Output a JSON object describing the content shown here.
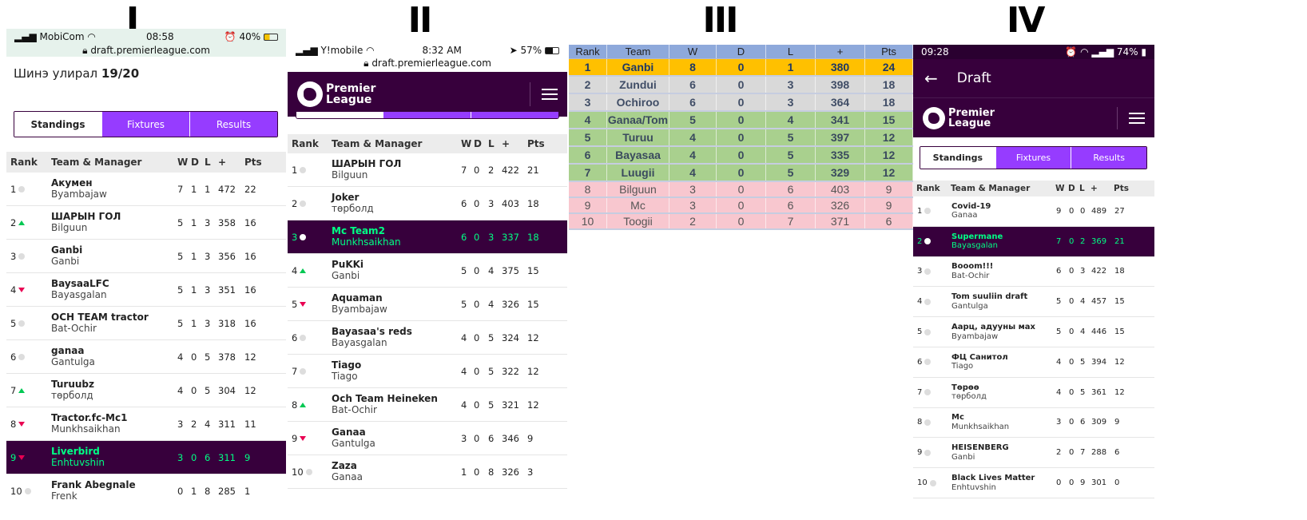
{
  "labels": [
    "I",
    "II",
    "III",
    "IV"
  ],
  "p1": {
    "status": {
      "carrier": "MobiCom",
      "time": "08:58",
      "battery": "40%"
    },
    "url": "draft.premierleague.com",
    "title_prefix": "Шинэ улирал",
    "title_season": "19/20",
    "tabs": [
      "Standings",
      "Fixtures",
      "Results"
    ],
    "headers": {
      "rank": "Rank",
      "team": "Team & Manager",
      "w": "W",
      "d": "D",
      "l": "L",
      "plus": "+",
      "pts": "Pts"
    },
    "rows": [
      {
        "rank": "1",
        "move": "same",
        "team": "Акумен",
        "mgr": "Byambajaw",
        "w": "7",
        "d": "1",
        "l": "1",
        "plus": "472",
        "pts": "22"
      },
      {
        "rank": "2",
        "move": "up",
        "team": "ШАРЫН ГОЛ",
        "mgr": "Bilguun",
        "w": "5",
        "d": "1",
        "l": "3",
        "plus": "358",
        "pts": "16"
      },
      {
        "rank": "3",
        "move": "same",
        "team": "Ganbi",
        "mgr": "Ganbi",
        "w": "5",
        "d": "1",
        "l": "3",
        "plus": "356",
        "pts": "16"
      },
      {
        "rank": "4",
        "move": "down",
        "team": "BaysaaLFC",
        "mgr": "Bayasgalan",
        "w": "5",
        "d": "1",
        "l": "3",
        "plus": "351",
        "pts": "16"
      },
      {
        "rank": "5",
        "move": "same",
        "team": "OCH TEAM tractor",
        "mgr": "Bat-Ochir",
        "w": "5",
        "d": "1",
        "l": "3",
        "plus": "318",
        "pts": "16"
      },
      {
        "rank": "6",
        "move": "same",
        "team": "ganaa",
        "mgr": "Gantulga",
        "w": "4",
        "d": "0",
        "l": "5",
        "plus": "378",
        "pts": "12"
      },
      {
        "rank": "7",
        "move": "up",
        "team": "Turuubz",
        "mgr": "төрболд",
        "w": "4",
        "d": "0",
        "l": "5",
        "plus": "304",
        "pts": "12"
      },
      {
        "rank": "8",
        "move": "down",
        "team": "Tractor.fc-Mc1",
        "mgr": "Munkhsaikhan",
        "w": "3",
        "d": "2",
        "l": "4",
        "plus": "311",
        "pts": "11"
      },
      {
        "rank": "9",
        "move": "down",
        "team": "Liverbird",
        "mgr": "Enhtuvshin",
        "w": "3",
        "d": "0",
        "l": "6",
        "plus": "311",
        "pts": "9",
        "hl": true
      },
      {
        "rank": "10",
        "move": "same",
        "team": "Frank Abegnale",
        "mgr": "Frenk",
        "w": "0",
        "d": "1",
        "l": "8",
        "plus": "285",
        "pts": "1"
      }
    ]
  },
  "p2": {
    "status": {
      "carrier": "Y!mobile",
      "time": "8:32 AM",
      "battery": "57%"
    },
    "url": "draft.premierleague.com",
    "logo": [
      "Premier",
      "League"
    ],
    "headers": {
      "rank": "Rank",
      "team": "Team & Manager",
      "w": "W",
      "d": "D",
      "l": "L",
      "plus": "+",
      "pts": "Pts"
    },
    "rows": [
      {
        "rank": "1",
        "move": "same",
        "team": "ШАРЫН ГОЛ",
        "mgr": "Bilguun",
        "w": "7",
        "d": "0",
        "l": "2",
        "plus": "422",
        "pts": "21"
      },
      {
        "rank": "2",
        "move": "same",
        "team": "Joker",
        "mgr": "төрболд",
        "w": "6",
        "d": "0",
        "l": "3",
        "plus": "403",
        "pts": "18"
      },
      {
        "rank": "3",
        "move": "same",
        "team": "Mc Team2",
        "mgr": "Munkhsaikhan",
        "w": "6",
        "d": "0",
        "l": "3",
        "plus": "337",
        "pts": "18",
        "hl": true
      },
      {
        "rank": "4",
        "move": "up",
        "team": "PuKKi",
        "mgr": "Ganbi",
        "w": "5",
        "d": "0",
        "l": "4",
        "plus": "375",
        "pts": "15"
      },
      {
        "rank": "5",
        "move": "down",
        "team": "Aquaman",
        "mgr": "Byambajaw",
        "w": "5",
        "d": "0",
        "l": "4",
        "plus": "326",
        "pts": "15"
      },
      {
        "rank": "6",
        "move": "same",
        "team": "Bayasaa's reds",
        "mgr": "Bayasgalan",
        "w": "4",
        "d": "0",
        "l": "5",
        "plus": "324",
        "pts": "12"
      },
      {
        "rank": "7",
        "move": "same",
        "team": "Tiago",
        "mgr": "Tiago",
        "w": "4",
        "d": "0",
        "l": "5",
        "plus": "322",
        "pts": "12"
      },
      {
        "rank": "8",
        "move": "up",
        "team": "Och Team Heineken",
        "mgr": "Bat-Ochir",
        "w": "4",
        "d": "0",
        "l": "5",
        "plus": "321",
        "pts": "12"
      },
      {
        "rank": "9",
        "move": "down",
        "team": "Ganaa",
        "mgr": "Gantulga",
        "w": "3",
        "d": "0",
        "l": "6",
        "plus": "346",
        "pts": "9"
      },
      {
        "rank": "10",
        "move": "same",
        "team": "Zaza",
        "mgr": "Ganaa",
        "w": "1",
        "d": "0",
        "l": "8",
        "plus": "326",
        "pts": "3"
      }
    ]
  },
  "p3": {
    "headers": [
      "Rank",
      "Team",
      "W",
      "D",
      "L",
      "+",
      "Pts"
    ],
    "rows": [
      {
        "c": [
          "1",
          "Ganbi",
          "8",
          "0",
          "1",
          "380",
          "24"
        ],
        "color": "gold"
      },
      {
        "c": [
          "2",
          "Zundui",
          "6",
          "0",
          "3",
          "398",
          "18"
        ],
        "color": "grey"
      },
      {
        "c": [
          "3",
          "Ochiroo",
          "6",
          "0",
          "3",
          "364",
          "18"
        ],
        "color": "grey"
      },
      {
        "c": [
          "4",
          "Ganaa/Tom",
          "5",
          "0",
          "4",
          "341",
          "15"
        ],
        "color": "green"
      },
      {
        "c": [
          "5",
          "Turuu",
          "4",
          "0",
          "5",
          "397",
          "12"
        ],
        "color": "green"
      },
      {
        "c": [
          "6",
          "Bayasaa",
          "4",
          "0",
          "5",
          "335",
          "12"
        ],
        "color": "green"
      },
      {
        "c": [
          "7",
          "Luugii",
          "4",
          "0",
          "5",
          "329",
          "12"
        ],
        "color": "green"
      },
      {
        "c": [
          "8",
          "Bilguun",
          "3",
          "0",
          "6",
          "403",
          "9"
        ],
        "color": "pink"
      },
      {
        "c": [
          "9",
          "Mc",
          "3",
          "0",
          "6",
          "326",
          "9"
        ],
        "color": "pink"
      },
      {
        "c": [
          "10",
          "Toogii",
          "2",
          "0",
          "7",
          "371",
          "6"
        ],
        "color": "pink"
      }
    ]
  },
  "p4": {
    "status": {
      "time": "09:28",
      "battery": "74%"
    },
    "appbar_title": "Draft",
    "logo": [
      "Premier",
      "League"
    ],
    "tabs": [
      "Standings",
      "Fixtures",
      "Results"
    ],
    "headers": {
      "rank": "Rank",
      "team": "Team & Manager",
      "w": "W",
      "d": "D",
      "l": "L",
      "plus": "+",
      "pts": "Pts"
    },
    "rows": [
      {
        "rank": "1",
        "move": "same",
        "team": "Covid-19",
        "mgr": "Ganaa",
        "w": "9",
        "d": "0",
        "l": "0",
        "plus": "489",
        "pts": "27"
      },
      {
        "rank": "2",
        "move": "same",
        "team": "Supermane",
        "mgr": "Bayasgalan",
        "w": "7",
        "d": "0",
        "l": "2",
        "plus": "369",
        "pts": "21",
        "hl": true
      },
      {
        "rank": "3",
        "move": "same",
        "team": "Booom!!!",
        "mgr": "Bat-Ochir",
        "w": "6",
        "d": "0",
        "l": "3",
        "plus": "422",
        "pts": "18"
      },
      {
        "rank": "4",
        "move": "same",
        "team": "Tom suuliin draft",
        "mgr": "Gantulga",
        "w": "5",
        "d": "0",
        "l": "4",
        "plus": "457",
        "pts": "15"
      },
      {
        "rank": "5",
        "move": "same",
        "team": "Аарц, адууны мах",
        "mgr": "Byambajaw",
        "w": "5",
        "d": "0",
        "l": "4",
        "plus": "446",
        "pts": "15"
      },
      {
        "rank": "6",
        "move": "same",
        "team": "ФЦ Санитол",
        "mgr": "Tiago",
        "w": "4",
        "d": "0",
        "l": "5",
        "plus": "394",
        "pts": "12"
      },
      {
        "rank": "7",
        "move": "same",
        "team": "Төрөө",
        "mgr": "төрболд",
        "w": "4",
        "d": "0",
        "l": "5",
        "plus": "361",
        "pts": "12"
      },
      {
        "rank": "8",
        "move": "same",
        "team": "Mc",
        "mgr": "Munkhsaikhan",
        "w": "3",
        "d": "0",
        "l": "6",
        "plus": "309",
        "pts": "9"
      },
      {
        "rank": "9",
        "move": "same",
        "team": "HEISENBERG",
        "mgr": "Ganbi",
        "w": "2",
        "d": "0",
        "l": "7",
        "plus": "288",
        "pts": "6"
      },
      {
        "rank": "10",
        "move": "same",
        "team": "Black Lives Matter",
        "mgr": "Enhtuvshin",
        "w": "0",
        "d": "0",
        "l": "9",
        "plus": "301",
        "pts": "0"
      }
    ]
  }
}
